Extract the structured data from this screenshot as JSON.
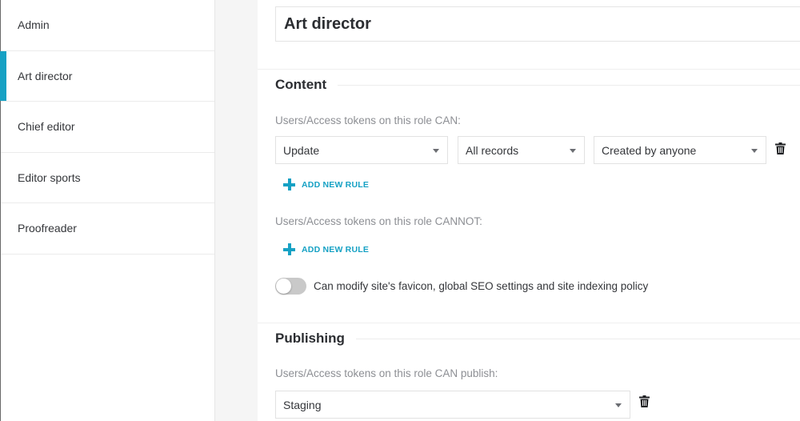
{
  "sidebar": {
    "items": [
      {
        "label": "Admin"
      },
      {
        "label": "Art director"
      },
      {
        "label": "Chief editor"
      },
      {
        "label": "Editor sports"
      },
      {
        "label": "Proofreader"
      }
    ],
    "active_index": 1
  },
  "role": {
    "name": "Art director"
  },
  "content": {
    "heading": "Content",
    "can_caption": "Users/Access tokens on this role CAN:",
    "rule": {
      "action": "Update",
      "records": "All records",
      "creator": "Created by anyone"
    },
    "add_rule_label": "ADD NEW RULE",
    "cannot_caption": "Users/Access tokens on this role CANNOT:",
    "toggle_label": "Can modify site's favicon, global SEO settings and site indexing policy",
    "toggle_on": false
  },
  "publishing": {
    "heading": "Publishing",
    "caption": "Users/Access tokens on this role CAN publish:",
    "environment": "Staging"
  },
  "colors": {
    "accent": "#16a1c4",
    "text": "#34363a",
    "muted": "#8d8f94"
  },
  "icons": {
    "delete": "trash-icon",
    "dropdown": "chevron-down-icon",
    "add": "plus-icon"
  }
}
